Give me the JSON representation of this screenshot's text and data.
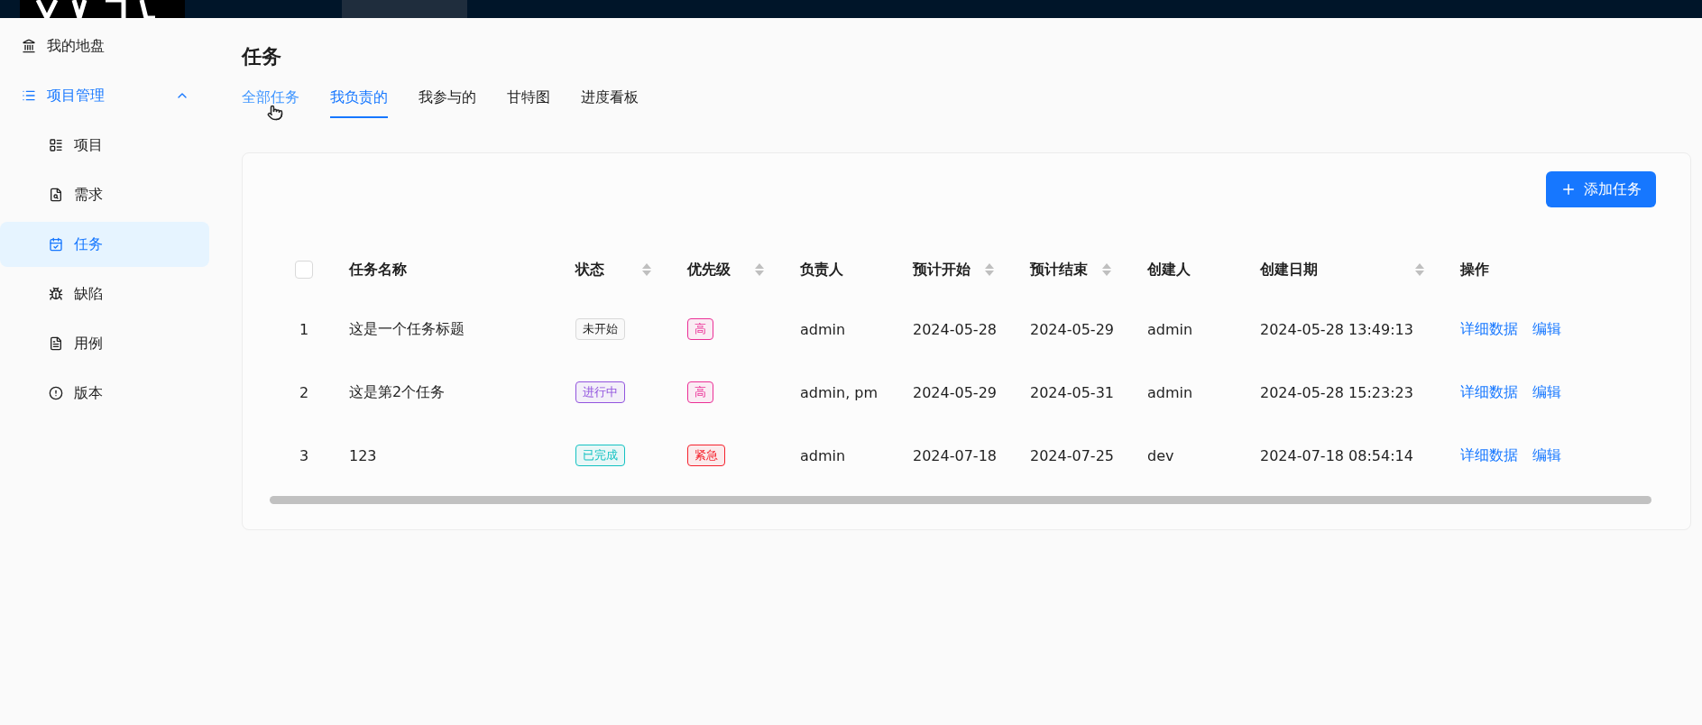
{
  "sidebar": {
    "items": [
      {
        "label": "我的地盘",
        "selected": false
      },
      {
        "label": "项目管理",
        "selected": false,
        "expanded": true,
        "children": [
          {
            "label": "项目",
            "selected": false
          },
          {
            "label": "需求",
            "selected": false
          },
          {
            "label": "任务",
            "selected": true
          },
          {
            "label": "缺陷",
            "selected": false
          },
          {
            "label": "用例",
            "selected": false
          },
          {
            "label": "版本",
            "selected": false
          }
        ]
      }
    ]
  },
  "page": {
    "title": "任务"
  },
  "tabs": [
    {
      "label": "全部任务",
      "selected": false,
      "hovered": true
    },
    {
      "label": "我负责的",
      "selected": true,
      "hovered": false
    },
    {
      "label": "我参与的",
      "selected": false,
      "hovered": false
    },
    {
      "label": "甘特图",
      "selected": false,
      "hovered": false
    },
    {
      "label": "进度看板",
      "selected": false,
      "hovered": false
    }
  ],
  "add_button": {
    "label": "添加任务"
  },
  "table": {
    "select_all": {
      "checked": false
    },
    "columns": [
      {
        "label": "任务名称",
        "sortable": false
      },
      {
        "label": "状态",
        "sortable": true
      },
      {
        "label": "优先级",
        "sortable": true
      },
      {
        "label": "负责人",
        "sortable": false
      },
      {
        "label": "预计开始",
        "sortable": true
      },
      {
        "label": "预计结束",
        "sortable": true
      },
      {
        "label": "创建人",
        "sortable": false
      },
      {
        "label": "创建日期",
        "sortable": true
      },
      {
        "label": "操作",
        "sortable": false
      }
    ],
    "rows": [
      {
        "index": "1",
        "name": "这是一个任务标题",
        "status": {
          "label": "未开始",
          "color": "#d9d9d9"
        },
        "priority": {
          "label": "高",
          "color": "#eb2f96"
        },
        "owner": "admin",
        "start": "2024-05-28",
        "end": "2024-05-29",
        "creator": "admin",
        "created": "2024-05-28 13:49:13",
        "actions": [
          "详细数据",
          "编辑"
        ]
      },
      {
        "index": "2",
        "name": "这是第2个任务",
        "status": {
          "label": "进行中",
          "color": "#9254de"
        },
        "priority": {
          "label": "高",
          "color": "#eb2f96"
        },
        "owner": "admin, pm",
        "start": "2024-05-29",
        "end": "2024-05-31",
        "creator": "admin",
        "created": "2024-05-28 15:23:23",
        "actions": [
          "详细数据",
          "编辑"
        ]
      },
      {
        "index": "3",
        "name": "123",
        "status": {
          "label": "已完成",
          "color": "#13c2c2"
        },
        "priority": {
          "label": "紧急",
          "color": "#f5222d"
        },
        "owner": "admin",
        "start": "2024-07-18",
        "end": "2024-07-25",
        "creator": "dev",
        "created": "2024-07-18 08:54:14",
        "actions": [
          "详细数据",
          "编辑"
        ]
      }
    ]
  }
}
